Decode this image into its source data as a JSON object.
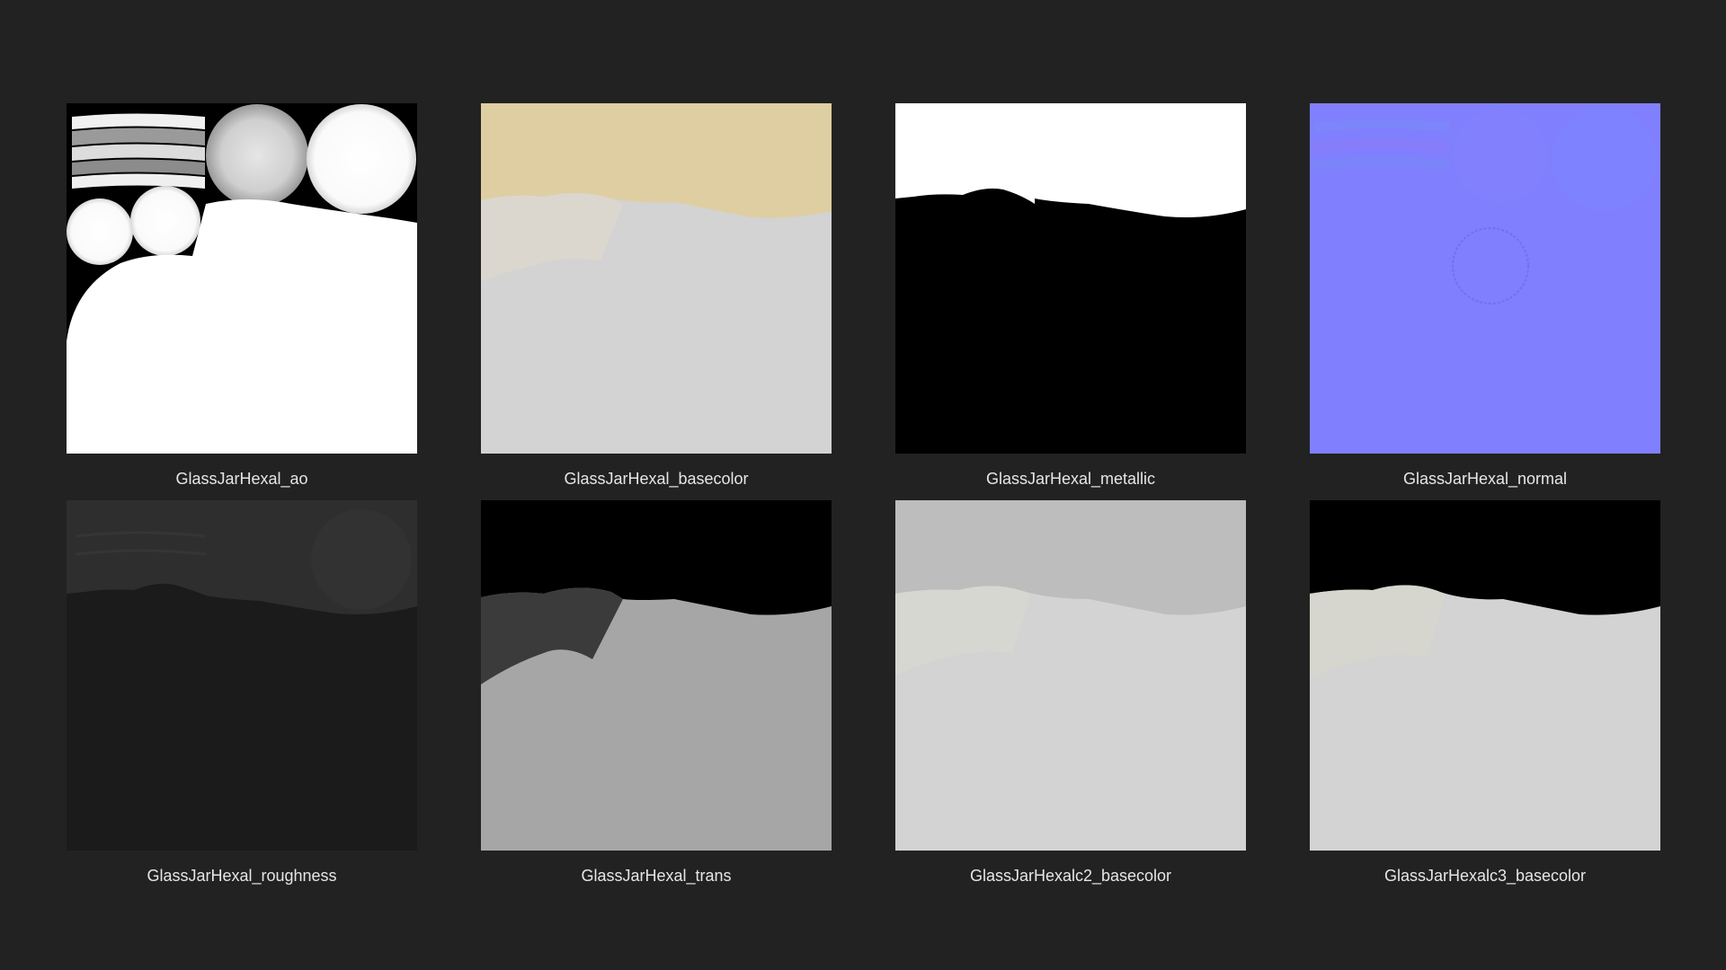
{
  "files": [
    {
      "name": "GlassJarHexal_ao",
      "preview": "ambient-occlusion-map"
    },
    {
      "name": "GlassJarHexal_basecolor",
      "preview": "base-color-map"
    },
    {
      "name": "GlassJarHexal_metallic",
      "preview": "metallic-map"
    },
    {
      "name": "GlassJarHexal_normal",
      "preview": "normal-map"
    },
    {
      "name": "GlassJarHexal_roughness",
      "preview": "roughness-map"
    },
    {
      "name": "GlassJarHexal_trans",
      "preview": "transmission-map"
    },
    {
      "name": "GlassJarHexalc2_basecolor",
      "preview": "base-color-map"
    },
    {
      "name": "GlassJarHexalc3_basecolor",
      "preview": "base-color-map"
    }
  ],
  "colors": {
    "background": "#222222",
    "caption_text": "#e6e6e6",
    "basecolor_cap": "#dfcea2",
    "basecolor_body": "#d3d3d3",
    "normal_base": "#8080fe",
    "roughness_base": "#1b1b1b"
  }
}
